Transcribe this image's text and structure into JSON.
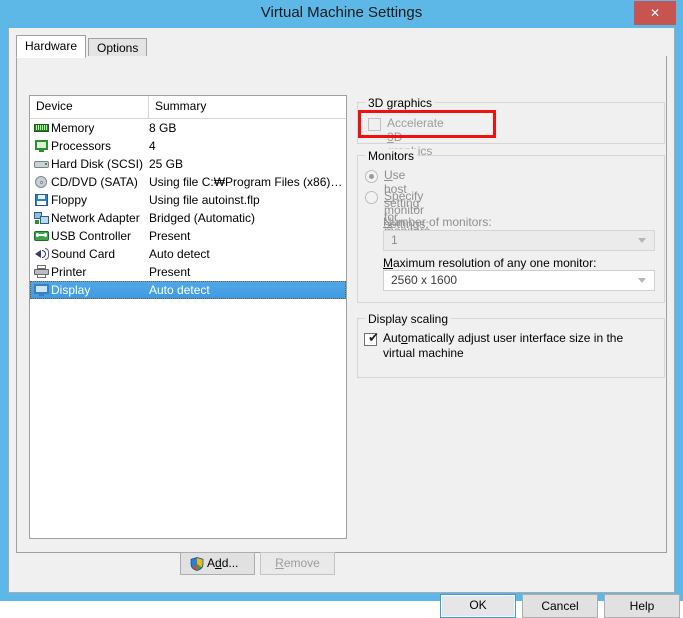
{
  "window": {
    "title": "Virtual Machine Settings",
    "close_label": "✕",
    "accent_titlebar": "#5db8e8",
    "accent_close": "#c75450"
  },
  "tabs": [
    {
      "label": "Hardware",
      "active": true
    },
    {
      "label": "Options",
      "active": false
    }
  ],
  "device_list": {
    "headers": {
      "device": "Device",
      "summary": "Summary"
    },
    "rows": [
      {
        "icon": "memory-icon",
        "device": "Memory",
        "summary": "8 GB"
      },
      {
        "icon": "processors-icon",
        "device": "Processors",
        "summary": "4"
      },
      {
        "icon": "hard-disk-icon",
        "device": "Hard Disk (SCSI)",
        "summary": "25 GB"
      },
      {
        "icon": "cd-dvd-icon",
        "device": "CD/DVD (SATA)",
        "summary": "Using file C:₩Program Files (x86)…"
      },
      {
        "icon": "floppy-icon",
        "device": "Floppy",
        "summary": "Using file autoinst.flp"
      },
      {
        "icon": "network-adapter-icon",
        "device": "Network Adapter",
        "summary": "Bridged (Automatic)"
      },
      {
        "icon": "usb-controller-icon",
        "device": "USB Controller",
        "summary": "Present"
      },
      {
        "icon": "sound-card-icon",
        "device": "Sound Card",
        "summary": "Auto detect"
      },
      {
        "icon": "printer-icon",
        "device": "Printer",
        "summary": "Present"
      },
      {
        "icon": "display-icon",
        "device": "Display",
        "summary": "Auto detect",
        "selected": true
      }
    ]
  },
  "list_buttons": {
    "add_label_before": "A",
    "add_label_accel": "d",
    "add_label_after": "d...",
    "add_full": "Add...",
    "remove_accel": "R",
    "remove_rest": "emove",
    "remove_full": "Remove",
    "remove_enabled": false
  },
  "graphics_3d": {
    "legend": "3D graphics",
    "checkbox": {
      "label_a": "Accelerate ",
      "label_accel": "3",
      "label_b": "D ",
      "label_accel2": "g",
      "label_c": "raphics",
      "full_label": "Accelerate 3D graphics",
      "checked": false,
      "enabled": false
    }
  },
  "monitors": {
    "legend": "Monitors",
    "radios": [
      {
        "accel": "U",
        "rest": "se host setting for monitors",
        "full": "Use host setting for monitors",
        "selected": true
      },
      {
        "accel": "S",
        "rest": "pecify monitor settings:",
        "full": "Specify monitor settings:",
        "selected": false
      }
    ],
    "number_label_accel": "N",
    "number_label_rest": "umber of monitors:",
    "number_label_full": "Number of monitors:",
    "number_value": "1",
    "max_res_label_accel": "M",
    "max_res_label_rest": "aximum resolution of any one monitor:",
    "max_res_label_full": "Maximum resolution of any one monitor:",
    "max_res_value": "2560 x 1600"
  },
  "display_scaling": {
    "legend": "Display scaling",
    "checkbox": {
      "line1_a": "Aut",
      "line1_accel": "o",
      "line1_b": "matically adjust user interface size in the virtual",
      "line2": "machine",
      "full_label": "Automatically adjust user interface size in the virtual machine",
      "tick": "✔",
      "checked": true
    }
  },
  "footer": {
    "ok": "OK",
    "cancel": "Cancel",
    "help": "Help"
  },
  "annotation": {
    "color": "#ee1111",
    "target": "Accelerate 3D graphics"
  }
}
